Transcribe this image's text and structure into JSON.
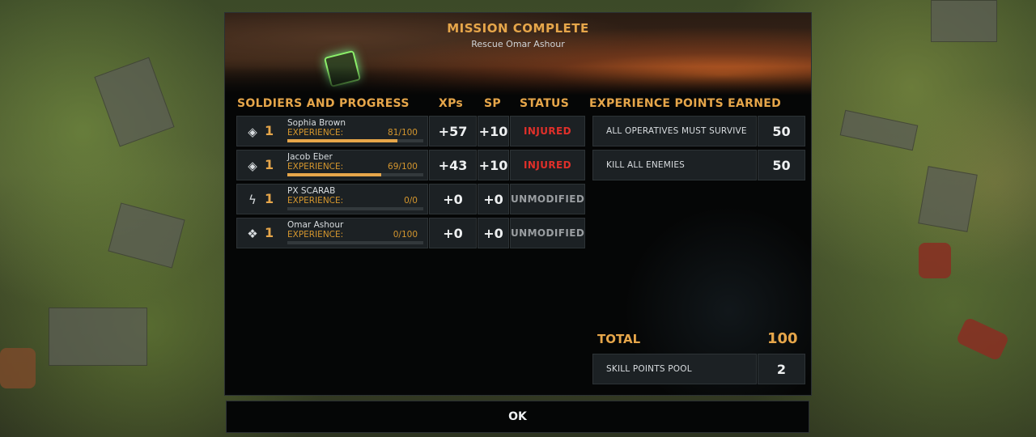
{
  "mission": {
    "title": "MISSION COMPLETE",
    "subtitle": "Rescue Omar Ashour"
  },
  "headers": {
    "soldiers": "SOLDIERS AND PROGRESS",
    "xps": "XPs",
    "sp": "SP",
    "status": "STATUS",
    "experience_earned": "EXPERIENCE POINTS EARNED"
  },
  "soldiers": [
    {
      "icon": "rank-chevron-icon",
      "rank": "1",
      "name": "Sophia Brown",
      "exp_label": "EXPERIENCE:",
      "exp_value": "81/100",
      "progress": 0.81,
      "xp": "+57",
      "sp": "+10",
      "status": "INJURED",
      "status_color": "#e0302a"
    },
    {
      "icon": "rank-chevron-icon",
      "rank": "1",
      "name": "Jacob Eber",
      "exp_label": "EXPERIENCE:",
      "exp_value": "69/100",
      "progress": 0.69,
      "xp": "+43",
      "sp": "+10",
      "status": "INJURED",
      "status_color": "#e0302a"
    },
    {
      "icon": "lightning-icon",
      "rank": "1",
      "name": "PX SCARAB",
      "exp_label": "EXPERIENCE:",
      "exp_value": "0/0",
      "progress": 0,
      "xp": "+0",
      "sp": "+0",
      "status": "UNMODIFIED",
      "status_color": "#9a9ea1"
    },
    {
      "icon": "diamond-cluster-icon",
      "rank": "1",
      "name": "Omar Ashour",
      "exp_label": "EXPERIENCE:",
      "exp_value": "0/100",
      "progress": 0,
      "xp": "+0",
      "sp": "+0",
      "status": "UNMODIFIED",
      "status_color": "#9a9ea1"
    }
  ],
  "objectives": [
    {
      "label": "ALL OPERATIVES MUST SURVIVE",
      "value": "50"
    },
    {
      "label": "KILL ALL ENEMIES",
      "value": "50"
    }
  ],
  "total": {
    "label": "TOTAL",
    "value": "100"
  },
  "skill_pool": {
    "label": "SKILL POINTS POOL",
    "value": "2"
  },
  "ok_label": "OK"
}
